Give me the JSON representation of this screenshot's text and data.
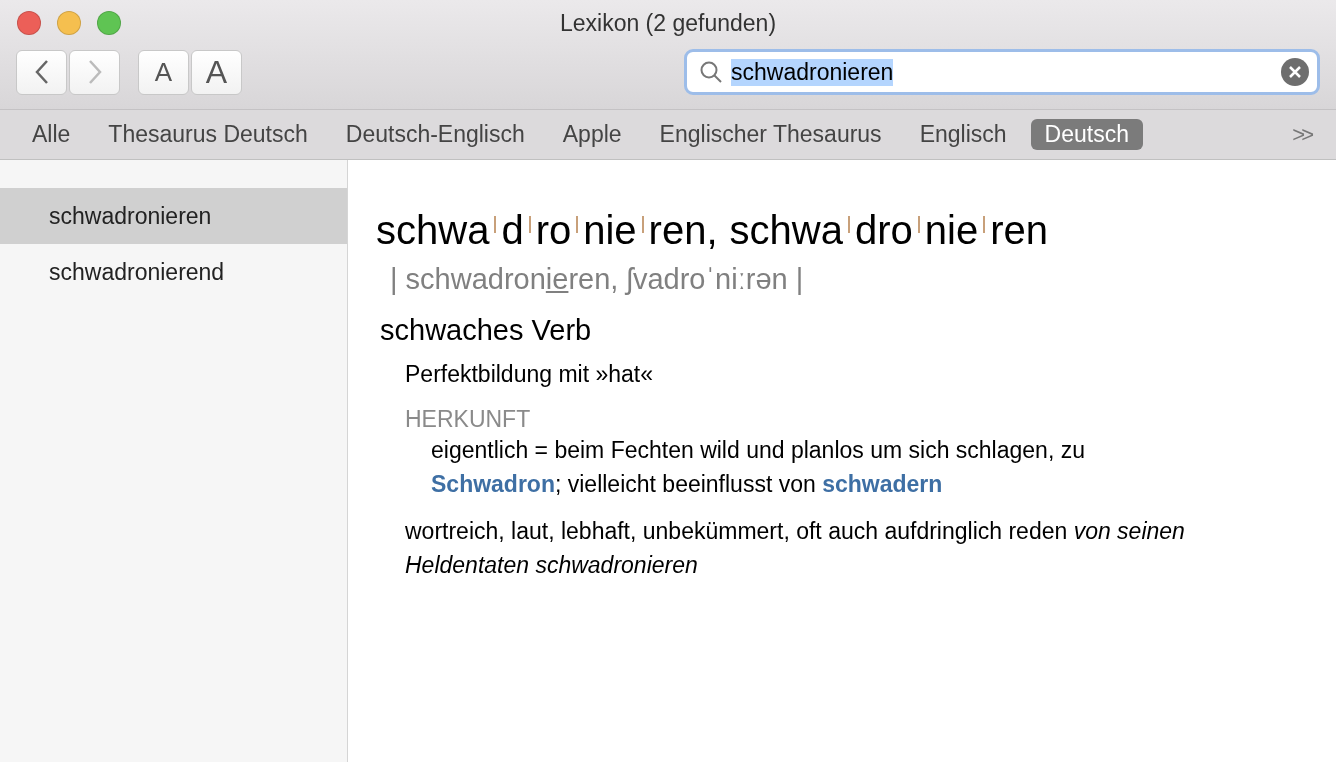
{
  "window": {
    "title": "Lexikon (2 gefunden)"
  },
  "toolbar": {
    "font_buttons": [
      "A",
      "A"
    ]
  },
  "search": {
    "value": "schwadronieren",
    "text_selected": true
  },
  "tabs": [
    {
      "label": "Alle",
      "selected": false
    },
    {
      "label": "Thesaurus Deutsch",
      "selected": false
    },
    {
      "label": "Deutsch-Englisch",
      "selected": false
    },
    {
      "label": "Apple",
      "selected": false
    },
    {
      "label": "Englischer Thesaurus",
      "selected": false
    },
    {
      "label": "Englisch",
      "selected": false
    },
    {
      "label": "Deutsch",
      "selected": true
    }
  ],
  "tabs_overflow": ">>",
  "sidebar": {
    "items": [
      {
        "label": "schwadronieren",
        "selected": true
      },
      {
        "label": "schwadronierend",
        "selected": false
      }
    ]
  },
  "entry": {
    "headwords": [
      {
        "syllables": [
          "schwa",
          "d",
          "ro",
          "nie",
          "ren"
        ]
      },
      {
        "syllables": [
          "schwa",
          "dro",
          "nie",
          "ren"
        ]
      }
    ],
    "headword_separator": ",",
    "pronunciation": {
      "before": "| schwadron",
      "stressed": "ie",
      "after": "ren, ʃvadroˈniːrən |"
    },
    "part_of_speech": "schwaches Verb",
    "grammar": "Perfektbildung mit »hat«",
    "etymology_label": "HERKUNFT",
    "etymology": [
      {
        "kind": "text",
        "text": "eigentlich = beim Fechten wild und planlos um sich schlagen, zu "
      },
      {
        "kind": "link",
        "text": "Schwadron"
      },
      {
        "kind": "text",
        "text": "; vielleicht beeinflusst von "
      },
      {
        "kind": "link",
        "text": "schwadern"
      }
    ],
    "definition": "wortreich, laut, lebhaft, unbekümmert, oft auch aufdringlich reden *von seinen Heldentaten schwadronieren*"
  }
}
